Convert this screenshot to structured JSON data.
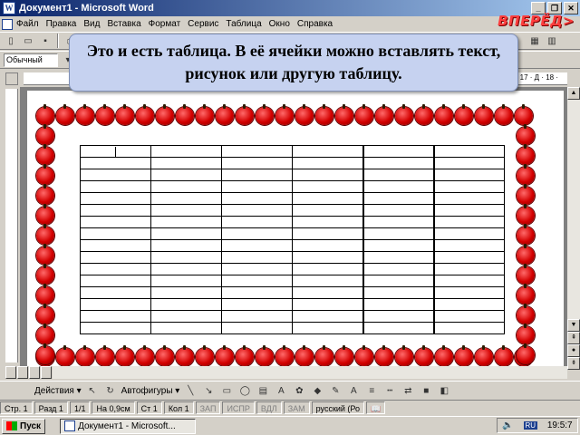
{
  "window": {
    "title": "Документ1 - Microsoft Word"
  },
  "menu": [
    "Файл",
    "Правка",
    "Вид",
    "Вставка",
    "Формат",
    "Сервис",
    "Таблица",
    "Окно",
    "Справка"
  ],
  "next_button": "ВПЕРЁД>",
  "toolbar": {
    "style_value": "Обычный"
  },
  "callout": {
    "text": "Это и есть таблица. В её ячейки можно вставлять текст, рисунок или другую таблицу."
  },
  "ruler": {
    "right_text": "· 17 · Д · 18 ·"
  },
  "drawing_toolbar": {
    "actions_label": "Действия ▾",
    "autoshapes_label": "Автофигуры ▾"
  },
  "statusbar": {
    "page": "Стр. 1",
    "section": "Разд 1",
    "pages": "1/1",
    "position": "На 0,9см",
    "line": "Ст 1",
    "column": "Кол 1",
    "rec": "ЗАП",
    "trk": "ИСПР",
    "ext": "ВДЛ",
    "ovr": "ЗАМ",
    "language": "русский (Ро"
  },
  "taskbar": {
    "start": "Пуск",
    "task": "Документ1 - Microsoft...",
    "lang": "RU",
    "time": "19:5:7"
  },
  "table": {
    "rows": 16,
    "cols": 6
  },
  "colors": {
    "callout_bg": "#c6d2f0",
    "next_button": "#ff3d3d",
    "apple_border": "#d30000"
  }
}
